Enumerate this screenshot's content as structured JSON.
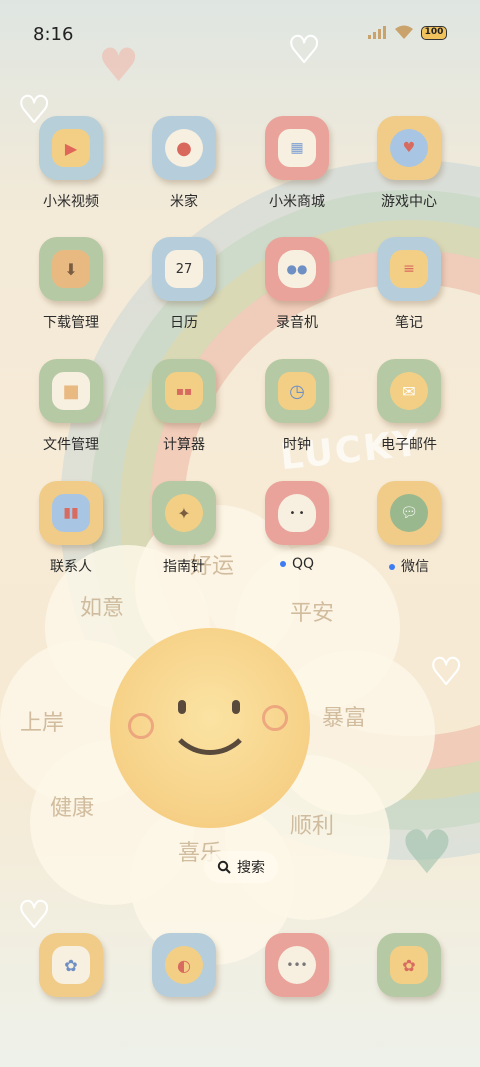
{
  "status_bar": {
    "time": "8:16",
    "battery": "100"
  },
  "apps": [
    {
      "label": "小米视频",
      "tile_color": "#b7cfd8",
      "icon": "video-icon"
    },
    {
      "label": "米家",
      "tile_color": "#b6cedb",
      "icon": "mijia-icon"
    },
    {
      "label": "小米商城",
      "tile_color": "#eaa39a",
      "icon": "shop-bag-icon"
    },
    {
      "label": "游戏中心",
      "tile_color": "#f0cc88",
      "icon": "gamepad-icon"
    },
    {
      "label": "下载管理",
      "tile_color": "#b5c9a4",
      "icon": "download-icon"
    },
    {
      "label": "日历",
      "tile_color": "#b6cedb",
      "icon": "calendar-icon",
      "calendar_day": "27"
    },
    {
      "label": "录音机",
      "tile_color": "#eaa39a",
      "icon": "recorder-icon"
    },
    {
      "label": "笔记",
      "tile_color": "#b6cedb",
      "icon": "notes-icon"
    },
    {
      "label": "文件管理",
      "tile_color": "#b5c9a4",
      "icon": "folder-icon"
    },
    {
      "label": "计算器",
      "tile_color": "#b5c9a4",
      "icon": "calculator-icon"
    },
    {
      "label": "时钟",
      "tile_color": "#b5c9a4",
      "icon": "clock-icon"
    },
    {
      "label": "电子邮件",
      "tile_color": "#b5c9a4",
      "icon": "mail-icon"
    },
    {
      "label": "联系人",
      "tile_color": "#f0cc88",
      "icon": "contacts-icon"
    },
    {
      "label": "指南针",
      "tile_color": "#b5c9a4",
      "icon": "compass-icon"
    },
    {
      "label": "QQ",
      "tile_color": "#eaa39a",
      "icon": "qq-penguin-icon",
      "notification": true
    },
    {
      "label": "微信",
      "tile_color": "#f0cc88",
      "icon": "wechat-icon",
      "notification": true
    }
  ],
  "search": {
    "label": "搜索"
  },
  "dock": [
    {
      "tile_color": "#f0cc88",
      "icon": "phone-icon"
    },
    {
      "tile_color": "#b6cedb",
      "icon": "browser-icon"
    },
    {
      "tile_color": "#eaa39a",
      "icon": "messages-icon"
    },
    {
      "tile_color": "#b5c9a4",
      "icon": "camera-icon"
    }
  ],
  "wallpaper": {
    "lucky_text": "LUCKY",
    "words": [
      "好运",
      "如意",
      "平安",
      "暴富",
      "顺利",
      "喜乐",
      "健康",
      "上岸"
    ]
  }
}
